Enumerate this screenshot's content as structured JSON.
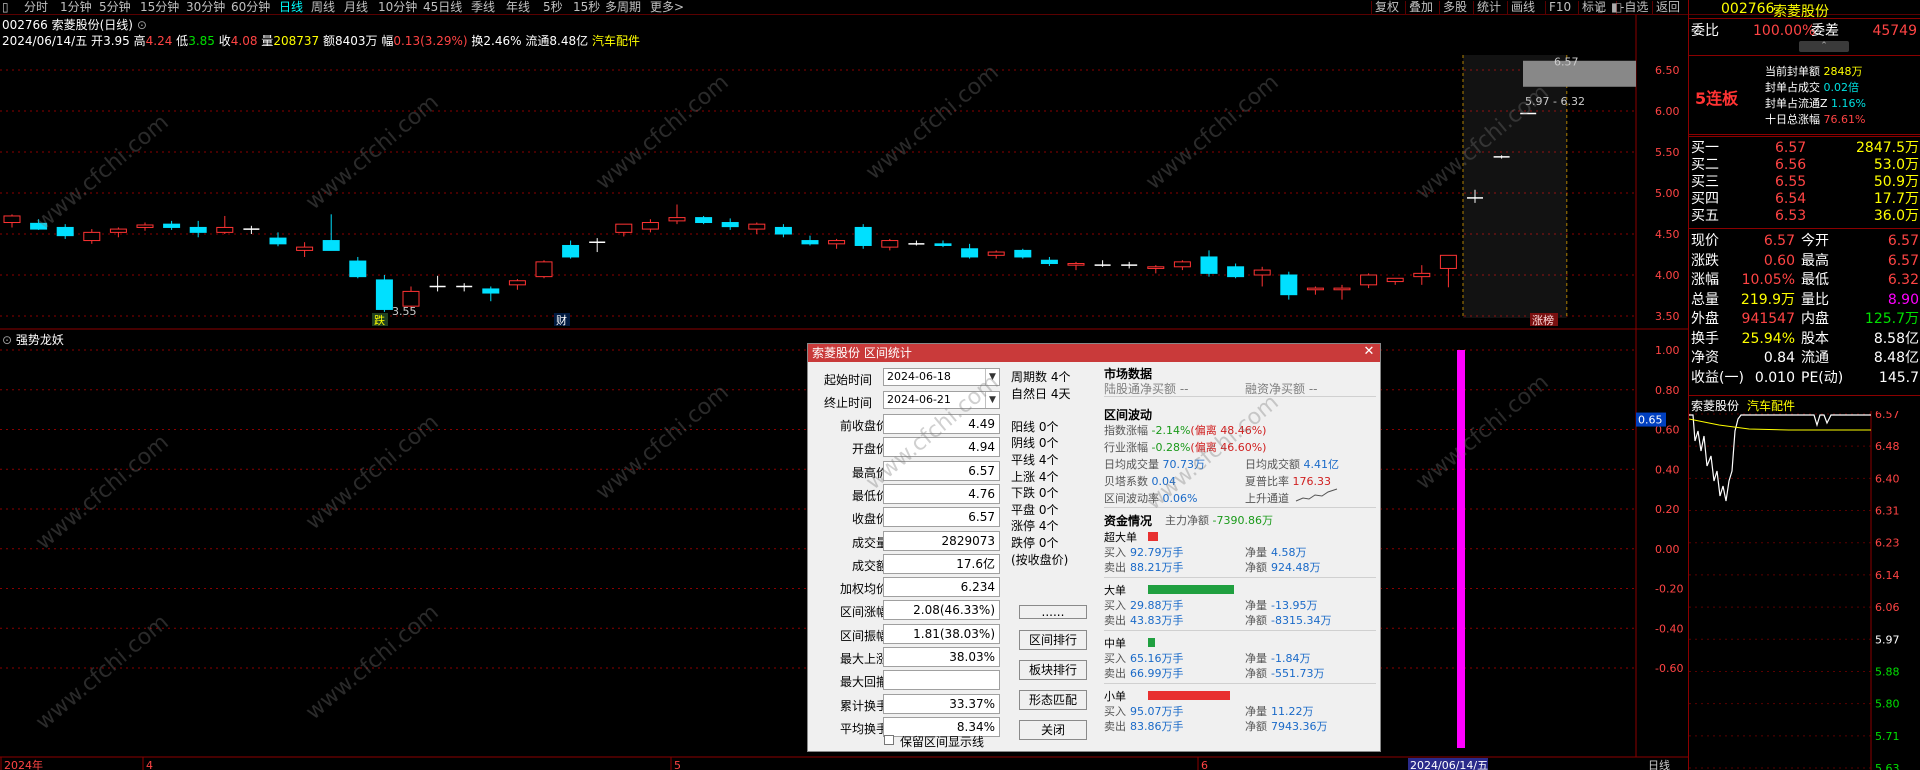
{
  "toolbar": {
    "left_icon": "▯",
    "periods": [
      "分时",
      "1分钟",
      "5分钟",
      "15分钟",
      "30分钟",
      "60分钟",
      "日线",
      "周线",
      "月线",
      "10分钟",
      "45日线",
      "季线",
      "年线",
      "5秒",
      "15秒",
      "多周期",
      "更多>"
    ],
    "active_period": "日线",
    "right_items": [
      "复权",
      "叠加",
      "多股",
      "统计",
      "画线",
      "F10",
      "标记",
      "-自选",
      "返回"
    ]
  },
  "chart_header": {
    "title": "002766 索菱股份(日线)",
    "date": "2024/06/14/五",
    "open_label": "开",
    "open": "3.95",
    "high_label": "高",
    "high": "4.24",
    "low_label": "低",
    "low": "3.85",
    "close_label": "收",
    "close": "4.08",
    "vol_label": "量",
    "vol": "208737",
    "amt_label": "额",
    "amt": "8403万",
    "amp_label": "幅",
    "amp": "0.13(3.29%)",
    "turn_label": "换",
    "turn": "2.46%",
    "float_label": "流通",
    "float": "8.48亿",
    "sector": "汽车配件"
  },
  "price_axis": [
    "6.50",
    "6.00",
    "5.50",
    "5.00",
    "4.50",
    "4.00",
    "3.50"
  ],
  "chart_markers": {
    "low_value": "3.55",
    "high_value": "6.57",
    "range_label": "5.97 - 6.32",
    "badge_die": "跌",
    "badge_cai": "财",
    "badge_zhangbang": "涨榜"
  },
  "indicator": {
    "name": "强势龙妖",
    "axis": [
      "1.00",
      "0.80",
      "0.60",
      "0.40",
      "0.20",
      "0.00",
      "-0.20",
      "-0.40",
      "-0.60"
    ],
    "current": "0.65"
  },
  "xaxis": {
    "labels": [
      "2024年",
      "4",
      "5",
      "6"
    ],
    "date_tag": "2024/06/14/五",
    "period_tag": "日线"
  },
  "dialog": {
    "title": "索菱股份 区间统计",
    "start_label": "起始时间",
    "start_date": "2024-06-18",
    "end_label": "终止时间",
    "end_date": "2024-06-21",
    "fields": [
      {
        "label": "前收盘价",
        "value": "4.49"
      },
      {
        "label": "开盘价",
        "value": "4.94"
      },
      {
        "label": "最高价",
        "value": "6.57"
      },
      {
        "label": "最低价",
        "value": "4.76"
      },
      {
        "label": "收盘价",
        "value": "6.57"
      },
      {
        "label": "成交量",
        "value": "2829073"
      },
      {
        "label": "成交额",
        "value": "17.6亿"
      },
      {
        "label": "加权均价",
        "value": "6.234"
      },
      {
        "label": "区间涨幅",
        "value": "2.08(46.33%)"
      },
      {
        "label": "区间振幅",
        "value": "1.81(38.03%)"
      },
      {
        "label": "最大上涨",
        "value": "38.03%"
      },
      {
        "label": "最大回撤",
        "value": ""
      },
      {
        "label": "累计换手",
        "value": "33.37%"
      },
      {
        "label": "平均换手",
        "value": "8.34%"
      }
    ],
    "keep_line": "保留区间显示线",
    "mid_stats": [
      "周期数 4个",
      "自然日 4天",
      "",
      "阳线 0个",
      "阴线 0个",
      "平线 4个",
      "上涨 4个",
      "下跌 0个",
      "平盘 0个",
      "涨停 4个",
      "跌停 0个",
      "(按收盘价)"
    ],
    "buttons": [
      "......",
      "区间排行",
      "板块排行",
      "形态匹配",
      "关闭"
    ],
    "market_title": "市场数据",
    "hk_buy": "陆股通净买额 --",
    "margin_buy": "融资净买额 --",
    "range_title": "区间波动",
    "idx_label": "指数涨幅",
    "idx_val": "-2.14%",
    "idx_dev": "(偏离 48.46%)",
    "ind_label": "行业涨幅",
    "ind_val": "-0.28%",
    "ind_dev": "(偏离 46.60%)",
    "avg_vol_label": "日均成交量",
    "avg_vol": "70.73万",
    "avg_amt_label": "日均成交额",
    "avg_amt": "4.41亿",
    "beta_label": "贝塔系数",
    "beta": "0.04",
    "sharpe_label": "夏普比率",
    "sharpe": "176.33",
    "volat_label": "区间波动率",
    "volat": "0.06%",
    "channel": "上升通道",
    "funds_title": "资金情况",
    "main_net_label": "主力净额",
    "main_net": "-7390.86万",
    "groups": [
      {
        "name": "超大单",
        "buy": "92.79万手",
        "sell": "88.21万手",
        "net_vol": "4.58万",
        "net_amt": "924.48万",
        "bar_color": "#e83030",
        "bar_frac": 0.08
      },
      {
        "name": "大单",
        "buy": "29.88万手",
        "sell": "43.83万手",
        "net_vol": "-13.95万",
        "net_amt": "-8315.34万",
        "bar_color": "#20a040",
        "bar_frac": 0.72
      },
      {
        "name": "中单",
        "buy": "65.16万手",
        "sell": "66.99万手",
        "net_vol": "-1.84万",
        "net_amt": "-551.73万",
        "bar_color": "#20a040",
        "bar_frac": 0.06
      },
      {
        "name": "小单",
        "buy": "95.07万手",
        "sell": "83.86万手",
        "net_vol": "11.22万",
        "net_amt": "7943.36万",
        "bar_color": "#e83030",
        "bar_frac": 0.68
      }
    ],
    "buy_label": "买入",
    "sell_label": "卖出",
    "net_label": "净量",
    "net_amt_label": "净额"
  },
  "side": {
    "code": "002766",
    "name": "索菱股份",
    "wb_label": "委比",
    "wb": "100.00%",
    "wc_label": "委差",
    "wc": "45749",
    "lianban": "5连板",
    "seal_amt_label": "当前封单额",
    "seal_amt": "2848万",
    "seal_ratio_label": "封单占成交",
    "seal_ratio": "0.02倍",
    "seal_float_label": "封单占流通Z",
    "seal_float": "1.16%",
    "ten_day_label": "十日总涨幅",
    "ten_day": "76.61%",
    "bids": [
      {
        "label": "买一",
        "price": "6.57",
        "vol": "2847.5万"
      },
      {
        "label": "买二",
        "price": "6.56",
        "vol": "53.0万"
      },
      {
        "label": "买三",
        "price": "6.55",
        "vol": "50.9万"
      },
      {
        "label": "买四",
        "price": "6.54",
        "vol": "17.7万"
      },
      {
        "label": "买五",
        "price": "6.53",
        "vol": "36.0万"
      }
    ],
    "quote": [
      {
        "l1": "现价",
        "v1": "6.57",
        "l2": "今开",
        "v2": "6.57",
        "c1": "#ff4444",
        "c2": "#ff4444"
      },
      {
        "l1": "涨跌",
        "v1": "0.60",
        "l2": "最高",
        "v2": "6.57",
        "c1": "#ff4444",
        "c2": "#ff4444"
      },
      {
        "l1": "涨幅",
        "v1": "10.05%",
        "l2": "最低",
        "v2": "6.32",
        "c1": "#ff4444",
        "c2": "#ff4444"
      },
      {
        "l1": "总量",
        "v1": "219.9万",
        "l2": "量比",
        "v2": "8.90",
        "c1": "#ffff00",
        "c2": "#ff00ff"
      },
      {
        "l1": "外盘",
        "v1": "941547",
        "l2": "内盘",
        "v2": "125.7万",
        "c1": "#ff4444",
        "c2": "#00e000"
      },
      {
        "l1": "换手",
        "v1": "25.94%",
        "l2": "股本",
        "v2": "8.58亿",
        "c1": "#ffff00",
        "c2": "#ffffff"
      },
      {
        "l1": "净资",
        "v1": "0.84",
        "l2": "流通",
        "v2": "8.48亿",
        "c1": "#ffffff",
        "c2": "#ffffff"
      },
      {
        "l1": "收益(一)",
        "v1": "0.010",
        "l2": "PE(动)",
        "v2": "145.7",
        "c1": "#ffffff",
        "c2": "#ffffff"
      }
    ],
    "mini_title": "索菱股份",
    "mini_sector": "汽车配件",
    "mini_axis": [
      "6.57",
      "6.48",
      "6.40",
      "6.31",
      "6.23",
      "6.14",
      "6.06",
      "5.97",
      "5.88",
      "5.80",
      "5.71",
      "5.63"
    ]
  },
  "watermark": "www.cfchi.com",
  "colors": {
    "up": "#ff3333",
    "down": "#00e0ff",
    "grid": "#8b0000",
    "accent": "#ff00ff"
  }
}
